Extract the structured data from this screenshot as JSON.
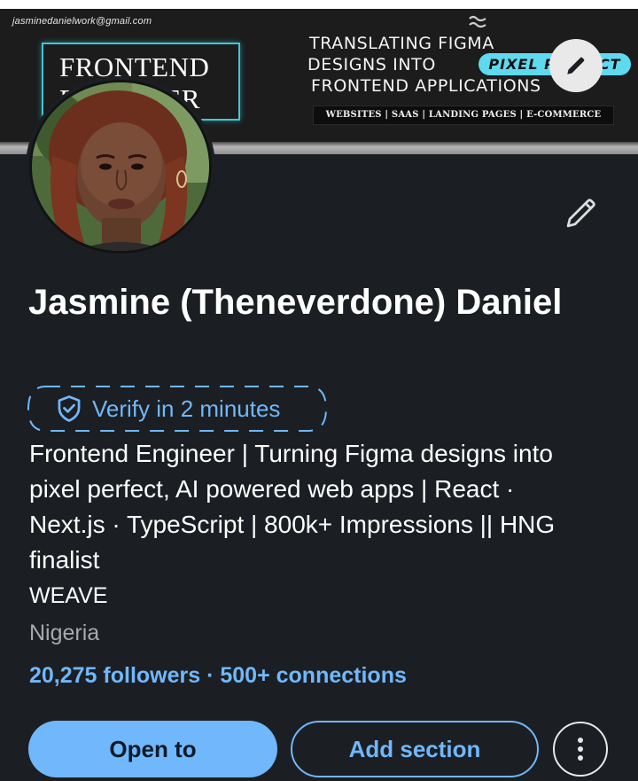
{
  "banner": {
    "email": "jasminedanielwork@gmail.com",
    "box_line1": "FRONTEND",
    "box_line2": "ENGINEER",
    "headline_line1": "TRANSLATING FIGMA",
    "headline_line2": "DESIGNS INTO",
    "pixel_pill": "PIXEL PERFECT",
    "headline_line3": "FRONTEND APPLICATIONS",
    "tags": "WEBSITES | SAAS | LANDING PAGES | E-COMMERCE"
  },
  "profile": {
    "name": "Jasmine (Theneverdone) Daniel",
    "verify_label": "Verify in 2 minutes",
    "headline": "Frontend Engineer | Turning Figma designs into pixel perfect, AI powered web apps | React · Next.js · TypeScript | 800k+ Impressions || HNG finalist",
    "company": "WEAVE",
    "location": "Nigeria",
    "followers": "20,275 followers",
    "separator": " · ",
    "connections": "500+ connections"
  },
  "actions": {
    "open_to": "Open to",
    "add_section": "Add section"
  },
  "icons": {
    "banner_edit": "pencil-icon",
    "profile_edit": "pencil-icon",
    "verify": "shield-check-icon",
    "more": "more-vertical-icon"
  },
  "colors": {
    "background": "#1b1f23",
    "accent": "#71b7fb",
    "text_secondary": "#a7a9ab",
    "banner_teal": "#3ec7d6",
    "pill": "#5fd9ee"
  }
}
